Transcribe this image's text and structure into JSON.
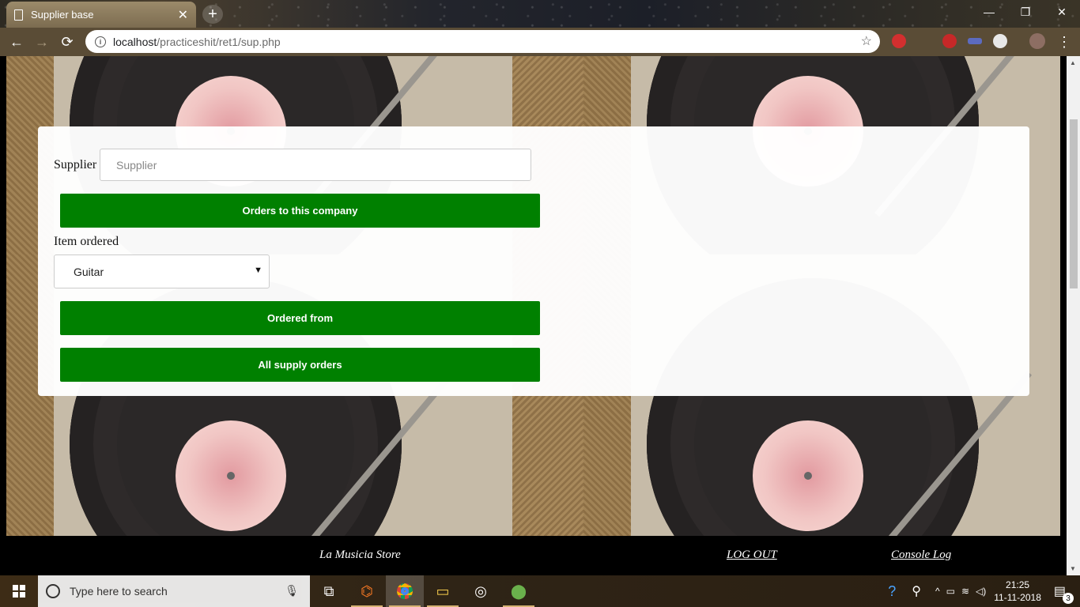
{
  "browser": {
    "tab_title": "Supplier base",
    "url_host": "localhost",
    "url_path": "/practiceshit/ret1/sup.php"
  },
  "form": {
    "supplier_label": "Supplier",
    "supplier_placeholder": "Supplier",
    "orders_button": "Orders to this company",
    "item_label": "Item ordered",
    "item_selected": "Guitar",
    "ordered_from_button": "Ordered from",
    "all_orders_button": "All supply orders"
  },
  "footer": {
    "store_name": "La Musicia Store",
    "logout_link": "LOG OUT",
    "console_link": "Console Log"
  },
  "taskbar": {
    "search_placeholder": "Type here to search",
    "time": "21:25",
    "date": "11-11-2018",
    "notification_count": "3"
  },
  "colors": {
    "button_green": "#008000",
    "footer_bg": "#000000"
  }
}
